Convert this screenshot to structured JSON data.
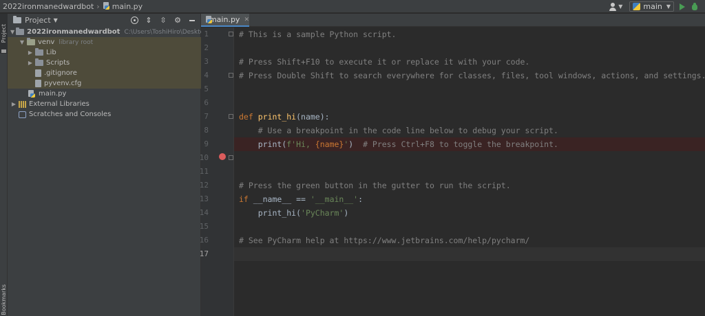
{
  "navbar": {
    "project_name": "2022ironmanedwardbot",
    "file_name": "main.py",
    "run_config_name": "main"
  },
  "tool_strip": {
    "project_tab": "Project",
    "bookmarks_tab": "Bookmarks"
  },
  "project_panel": {
    "title": "Project",
    "tree": [
      {
        "label": "2022ironmanedwardbot",
        "extra": "C:\\Users\\ToshiHiro\\Desktop\\Pytho"
      },
      {
        "label": "venv",
        "extra": "library root"
      },
      {
        "label": "Lib"
      },
      {
        "label": "Scripts"
      },
      {
        "label": ".gitignore"
      },
      {
        "label": "pyvenv.cfg"
      },
      {
        "label": "main.py"
      },
      {
        "label": "External Libraries"
      },
      {
        "label": "Scratches and Consoles"
      }
    ]
  },
  "editor": {
    "tab_label": "main.py",
    "line_numbers": [
      "1",
      "2",
      "3",
      "4",
      "5",
      "6",
      "7",
      "8",
      "9",
      "10",
      "11",
      "12",
      "13",
      "14",
      "15",
      "16",
      "17"
    ],
    "current_line": 17,
    "breakpoint_line": 9,
    "lines": {
      "l1": "# This is a sample Python script.",
      "l3": "# Press Shift+F10 to execute it or replace it with your code.",
      "l4": "# Press Double Shift to search everywhere for classes, files, tool windows, actions, and settings.",
      "l7_kw": "def",
      "l7_fn": "print_hi",
      "l7_rest": "(name):",
      "l8": "# Use a breakpoint in the code line below to debug your script.",
      "l9_a": "print(",
      "l9_str1": "f'Hi, ",
      "l9_b": "{name}",
      "l9_str2": "'",
      "l9_c": ")  ",
      "l9_cm": "# Press Ctrl+F8 to toggle the breakpoint.",
      "l12": "# Press the green button in the gutter to run the script.",
      "l13_kw": "if",
      "l13_mid": " __name__ == ",
      "l13_str": "'__main__'",
      "l13_end": ":",
      "l14_a": "print_hi(",
      "l14_str": "'PyCharm'",
      "l14_b": ")",
      "l16": "# See PyCharm help at https://www.jetbrains.com/help/pycharm/"
    }
  }
}
